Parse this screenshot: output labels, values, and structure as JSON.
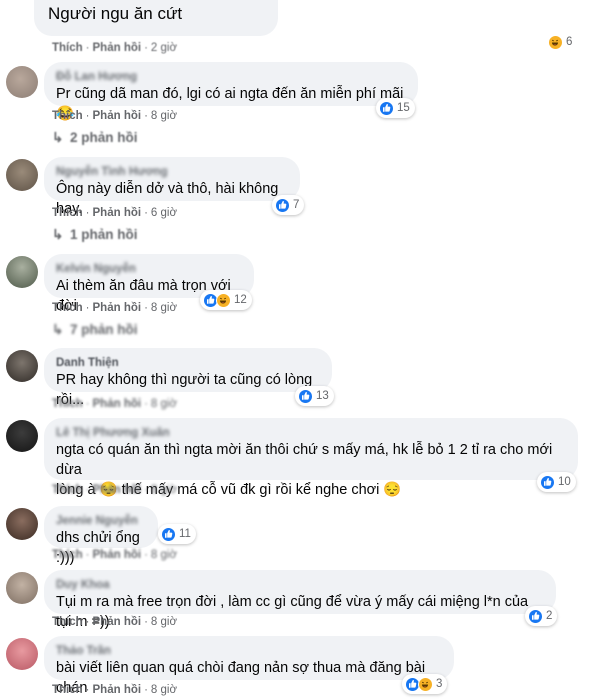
{
  "top_comment": {
    "text": "Người ngu ăn cứt",
    "like_label": "Thích",
    "reply_label": "Phản hồi",
    "time": "2 giờ",
    "reaction_count": "6"
  },
  "comments": [
    {
      "author": "Đỗ Lan Hương",
      "text": "Pr cũng dã man đó, lgi có ai ngta đến ăn miễn phí mãi 😂",
      "like_label": "Thích",
      "reply_label": "Phản hồi",
      "time": "8 giờ",
      "reaction_count": "15",
      "replies_text": "2 phản hồi"
    },
    {
      "author": "Nguyễn Tình Hương",
      "text": "Ông này diễn dở và thô, hài không hay.",
      "like_label": "Thích",
      "reply_label": "Phản hồi",
      "time": "6 giờ",
      "reaction_count": "7",
      "replies_text": "1 phản hồi"
    },
    {
      "author": "Kelvin Nguyễn",
      "text": "Ai thèm ăn đâu mà trọn với đời",
      "like_label": "Thích",
      "reply_label": "Phản hồi",
      "time": "8 giờ",
      "reaction_count": "12",
      "replies_text": "7 phản hồi"
    },
    {
      "author": "Danh Thiện",
      "text": "PR hay không thì người ta cũng có lòng rồi...",
      "like_label": "Thích",
      "reply_label": "Phản hồi",
      "time": "8 giờ",
      "reaction_count": "13"
    },
    {
      "author": "Lê Thị Phương Xuân",
      "text_line1": "ngta có quán ăn thì ngta mời ăn thôi chứ s mấy má, hk lễ bỏ 1 2 tỉ ra cho mới dừa",
      "text_line2": "lòng à 😔 thế mấy má cỗ vũ đk gì rồi kể nghe chơi 😔",
      "like_label": "Thích",
      "reply_label": "Phản hồi",
      "time": "8 giờ",
      "reaction_count": "10"
    },
    {
      "author": "Jennie Nguyễn",
      "text": "dhs chửi ổng :)))",
      "like_label": "Thích",
      "reply_label": "Phản hồi",
      "time": "8 giờ",
      "reaction_count": "11"
    },
    {
      "author": "Duy Khoa",
      "text": "Tụi m ra mà free trọn đời , làm cc gì cũng để vừa ý mấy cái miệng l*n của tụi m =))",
      "like_label": "Thích",
      "reply_label": "Phản hồi",
      "time": "8 giờ",
      "reaction_count": "2"
    },
    {
      "author": "Thảo Trần",
      "text": "bài viết liên quan quá chòi đang nản sợ thua mà đăng bài chán",
      "like_label": "Thích",
      "reply_label": "Phản hồi",
      "time": "8 giờ",
      "reaction_count": "3"
    }
  ],
  "colors": {
    "bubble": "#f0f2f5",
    "like": "#1877f2",
    "haha": "#f7b125",
    "meta_text": "#65676b"
  }
}
